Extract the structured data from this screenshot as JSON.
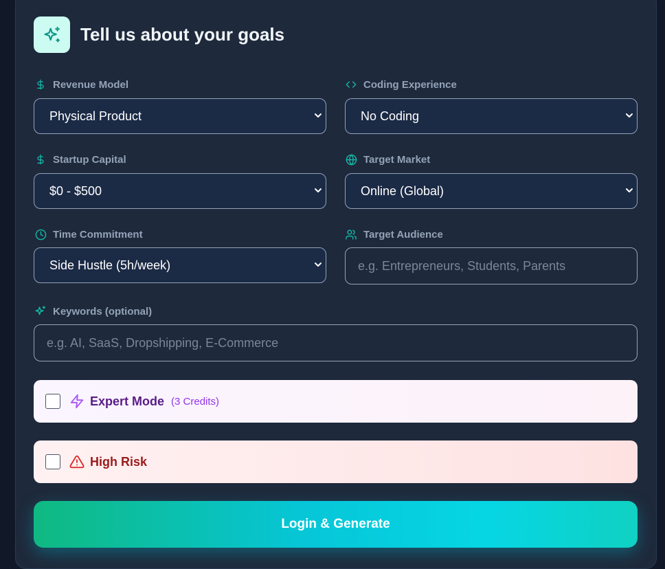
{
  "header": {
    "title": "Tell us about your goals",
    "icon": "sparkles-icon"
  },
  "fields": {
    "revenue_model": {
      "label": "Revenue Model",
      "icon": "dollar-icon",
      "value": "Physical Product"
    },
    "coding_experience": {
      "label": "Coding Experience",
      "icon": "code-icon",
      "value": "No Coding"
    },
    "startup_capital": {
      "label": "Startup Capital",
      "icon": "dollar-icon",
      "value": "$0 - $500"
    },
    "target_market": {
      "label": "Target Market",
      "icon": "globe-icon",
      "value": "Online (Global)"
    },
    "time_commitment": {
      "label": "Time Commitment",
      "icon": "clock-icon",
      "value": "Side Hustle (5h/week)"
    },
    "target_audience": {
      "label": "Target Audience",
      "icon": "users-icon",
      "value": "",
      "placeholder": "e.g. Entrepreneurs, Students, Parents"
    },
    "keywords": {
      "label": "Keywords (optional)",
      "icon": "sparkles-icon",
      "value": "",
      "placeholder": "e.g. AI, SaaS, Dropshipping, E-Commerce"
    }
  },
  "options": {
    "expert_mode": {
      "label": "Expert Mode",
      "note": "(3 Credits)",
      "icon": "zap-icon",
      "checked": false
    },
    "high_risk": {
      "label": "High Risk",
      "icon": "warning-triangle-icon",
      "checked": false
    }
  },
  "cta": {
    "label": "Login & Generate"
  },
  "colors": {
    "accent_teal": "#14b8a6",
    "card_bg": "#1e293b",
    "page_bg": "#111827",
    "expert_purple": "#581c87",
    "risk_red": "#991b1b"
  }
}
